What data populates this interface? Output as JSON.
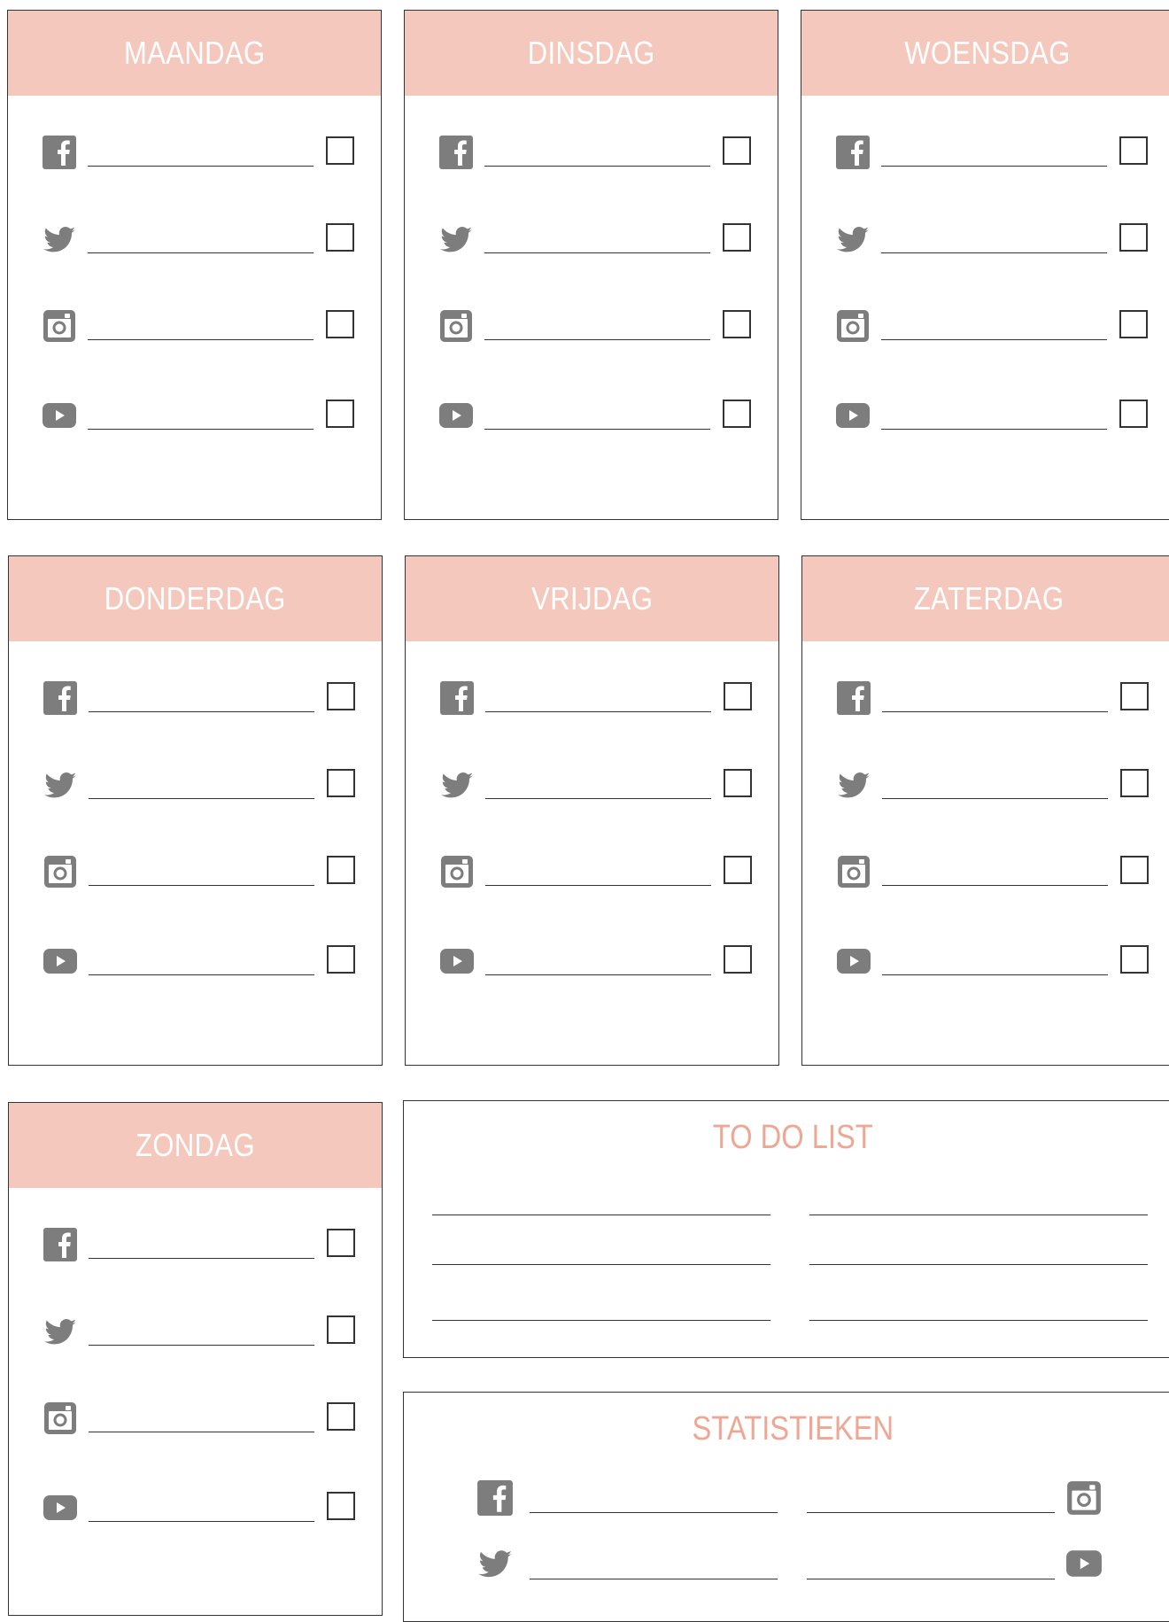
{
  "days": [
    {
      "label": "MAANDAG"
    },
    {
      "label": "DINSDAG"
    },
    {
      "label": "WOENSDAG"
    },
    {
      "label": "DONDERDAG"
    },
    {
      "label": "VRIJDAG"
    },
    {
      "label": "ZATERDAG"
    },
    {
      "label": "ZONDAG"
    }
  ],
  "platforms": [
    "facebook-icon",
    "twitter-icon",
    "instagram-icon",
    "youtube-icon"
  ],
  "todo": {
    "title": "TO DO LIST"
  },
  "stats": {
    "title": "STATISTIEKEN"
  },
  "colors": {
    "header_bg": "#f5c8bd",
    "title_accent": "#eea793",
    "icon_gray": "#7d7d7d"
  }
}
